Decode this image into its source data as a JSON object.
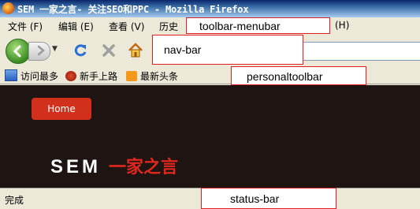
{
  "window": {
    "title": "SEM 一家之言- 关注SEO和PPC - Mozilla Firefox"
  },
  "menubar": {
    "items": [
      {
        "label": "文件 (F)"
      },
      {
        "label": "编辑 (E)"
      },
      {
        "label": "查看 (V)"
      },
      {
        "label": "历史"
      },
      {
        "label": "(H)"
      }
    ]
  },
  "bookmarks": {
    "items": [
      {
        "label": "访问最多"
      },
      {
        "label": "新手上路"
      },
      {
        "label": "最新头条"
      }
    ]
  },
  "content": {
    "home_button": "Home",
    "logo_sem": "SEM",
    "logo_cn": "一家之言"
  },
  "statusbar": {
    "text": "完成"
  },
  "annotations": {
    "menubar": "toolbar-menubar",
    "navbar": "nav-bar",
    "personaltoolbar": "personaltoolbar",
    "statusbar": "status-bar"
  },
  "colors": {
    "content_bg": "#1e1411",
    "accent_red": "#d0301c",
    "annotation_border": "#e02020"
  }
}
